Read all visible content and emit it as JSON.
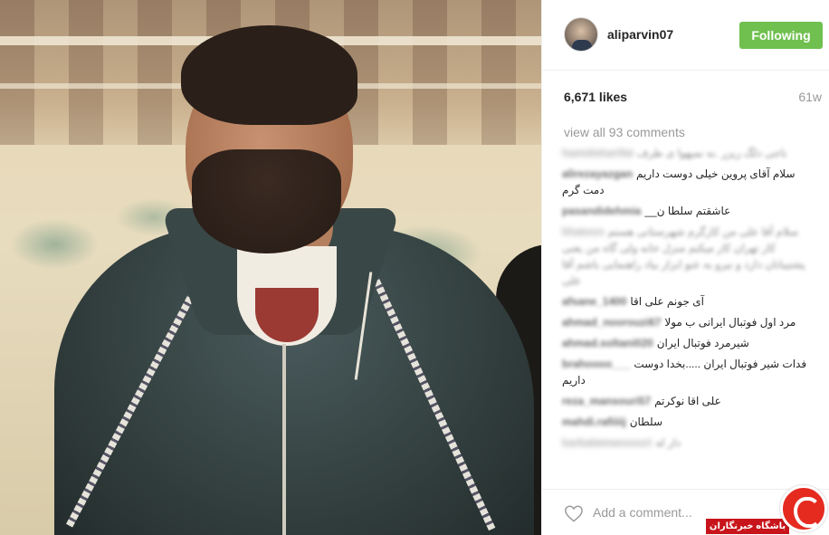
{
  "post": {
    "username": "aliparvin07",
    "follow_label": "Following",
    "likes": "6,671 likes",
    "time_ago": "61w",
    "view_all": "view all 93 comments",
    "add_comment_placeholder": "Add a comment..."
  },
  "comments": [
    {
      "user": "hamidsharifat",
      "text": "ناجی دلگ ریزر .نه نمیهوا ی طرف",
      "faded": true
    },
    {
      "user": "alirezayazgan",
      "text": "سلام آقای پروین خیلی دوست داریم دمت گرم",
      "faded": false
    },
    {
      "user": "pasandidehmia",
      "text": "عاشقتم سلطا ن__",
      "faded": false
    },
    {
      "user": "khatoon",
      "text": "سلام آقا علی من کارگرم شهرستانی هستم کار تهران کار میکنم منزل خانه ولی گاه من یعنی پشتیبانان دارد و نیرو به عنو ابزار بیاد راهنمایی باشم آقا علی",
      "faded": true
    },
    {
      "user": "afsane_1400",
      "text": "آی جونم علی اقا",
      "faded": false
    },
    {
      "user": "ahmad_noorouzi67",
      "text": "مرد اول فوتبال ایرانی ب مولا",
      "faded": false
    },
    {
      "user": "ahmad.soltani020",
      "text": "شیرمرد فوتبال ایران",
      "faded": false
    },
    {
      "user": "brahoooo___",
      "text": "فدات شیر فوتبال ایران .....بخدا دوست داریم",
      "faded": false
    },
    {
      "user": "reza_mansouri57",
      "text": "علی اقا نوکرتم",
      "faded": false
    },
    {
      "user": "mahdi.rafiiiij",
      "text": "سلطان",
      "faded": false
    },
    {
      "user": "karbalaimansouri",
      "text": "دار له",
      "faded": true
    }
  ],
  "watermark": {
    "label": "باشگاه خبرنگاران",
    "colors": {
      "bar": "#c8141b",
      "circle": "#e52a20"
    }
  },
  "colors": {
    "follow_button": "#70c050",
    "muted_text": "#999999"
  },
  "icons": {
    "heart": "heart-icon"
  }
}
